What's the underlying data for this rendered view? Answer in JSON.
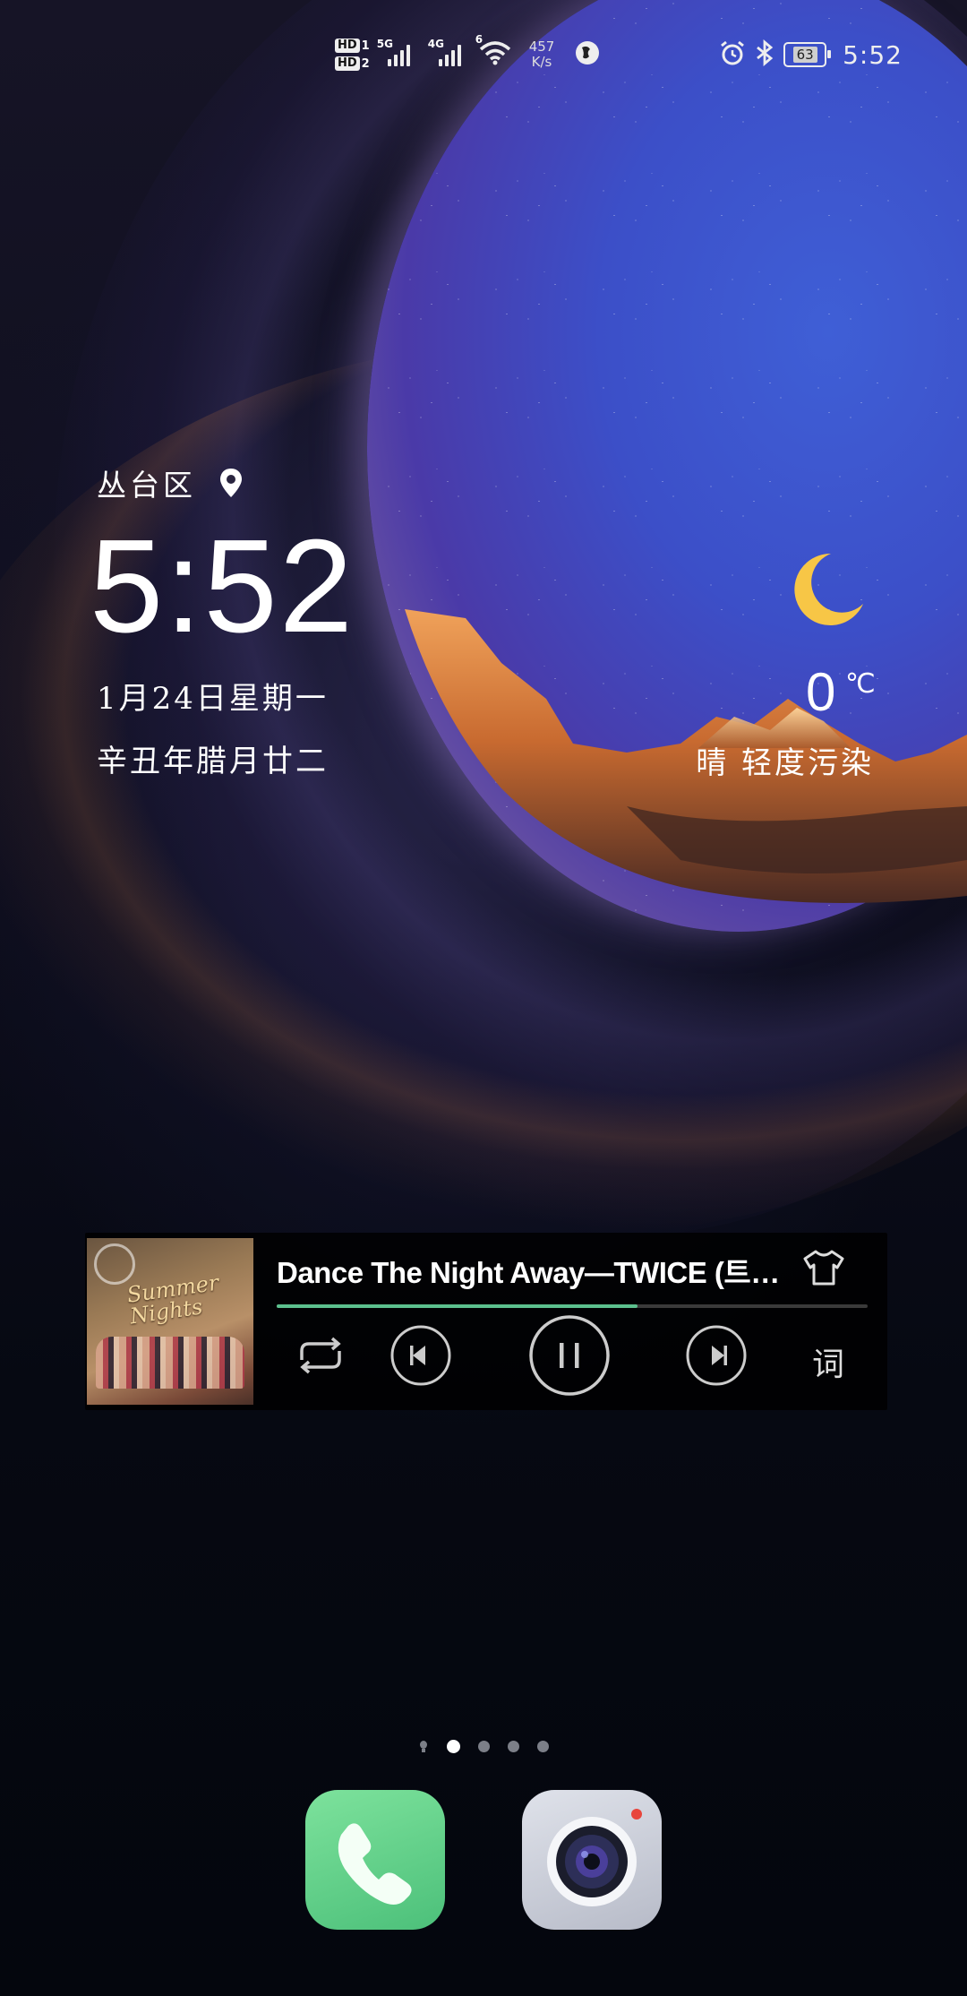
{
  "status_bar": {
    "hd1": "HD",
    "hd1_sim": "1",
    "hd2": "HD",
    "hd2_sim": "2",
    "signal1_label": "5G",
    "signal2_label": "4G",
    "wifi_label": "6",
    "speed_value": "457",
    "speed_unit": "K/s",
    "battery": "63",
    "time": "5:52",
    "icons": [
      "hd-icon",
      "signal-icon",
      "wifi-icon",
      "vpn-icon",
      "alarm-icon",
      "bluetooth-icon",
      "battery-icon"
    ]
  },
  "clock": {
    "location": "丛台区",
    "time": "5:52",
    "date": "1月24日星期一",
    "lunar_date": "辛丑年腊月廿二"
  },
  "weather": {
    "icon": "moon-icon",
    "temperature": "0",
    "unit": "℃",
    "description": "晴 轻度污染"
  },
  "music": {
    "album_art_text": "Summer Nights",
    "song": "Dance The Night Away—TWICE (트…",
    "progress": 0.61,
    "lyrics_label": "词",
    "accent": "#5cc08e",
    "controls": [
      "repeat-icon",
      "previous-icon",
      "pause-icon",
      "next-icon",
      "theme-shirt-icon"
    ]
  },
  "pages": {
    "count": 5,
    "active_index": 1
  },
  "dock": [
    {
      "name": "phone",
      "icon": "phone-icon",
      "color": "#5cc985"
    },
    {
      "name": "camera",
      "icon": "camera-icon",
      "color": "#c9ccd6"
    }
  ]
}
